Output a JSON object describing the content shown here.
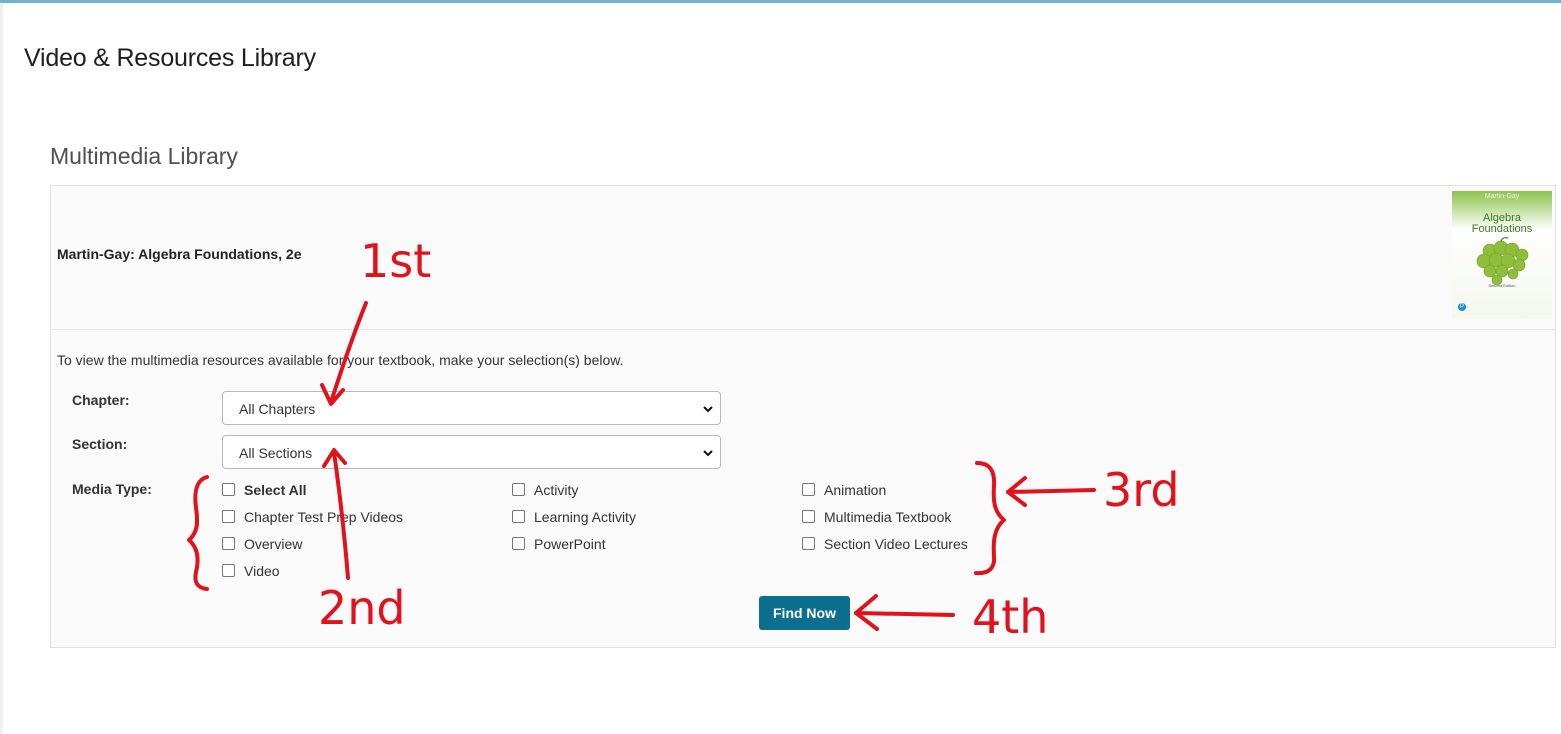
{
  "header": {
    "title": "Video & Resources Library"
  },
  "library": {
    "heading": "Multimedia Library",
    "book": {
      "title": "Martin-Gay: Algebra Foundations, 2e",
      "cover": {
        "author": "Martin-Gay",
        "title_line1": "Algebra",
        "title_line2": "Foundations",
        "edition": "Second Edition",
        "logo": "P"
      }
    },
    "instructions": "To view the multimedia resources available for your textbook, make your selection(s) below.",
    "chapter": {
      "label": "Chapter:",
      "value": "All Chapters"
    },
    "section": {
      "label": "Section:",
      "value": "All Sections"
    },
    "media_type": {
      "label": "Media Type:",
      "options": [
        {
          "label": "Select All"
        },
        {
          "label": "Activity"
        },
        {
          "label": "Animation"
        },
        {
          "label": "Chapter Test Prep Videos"
        },
        {
          "label": "Learning Activity"
        },
        {
          "label": "Multimedia Textbook"
        },
        {
          "label": "Overview"
        },
        {
          "label": "PowerPoint"
        },
        {
          "label": "Section Video Lectures"
        },
        {
          "label": "Video"
        }
      ]
    },
    "find_button": "Find Now"
  },
  "annotations": {
    "first": "1st",
    "second": "2nd",
    "third": "3rd",
    "fourth": "4th",
    "color": "#e0131c"
  },
  "colors": {
    "accent": "#0d6f8f",
    "top_bar": "#6fb3cf"
  }
}
